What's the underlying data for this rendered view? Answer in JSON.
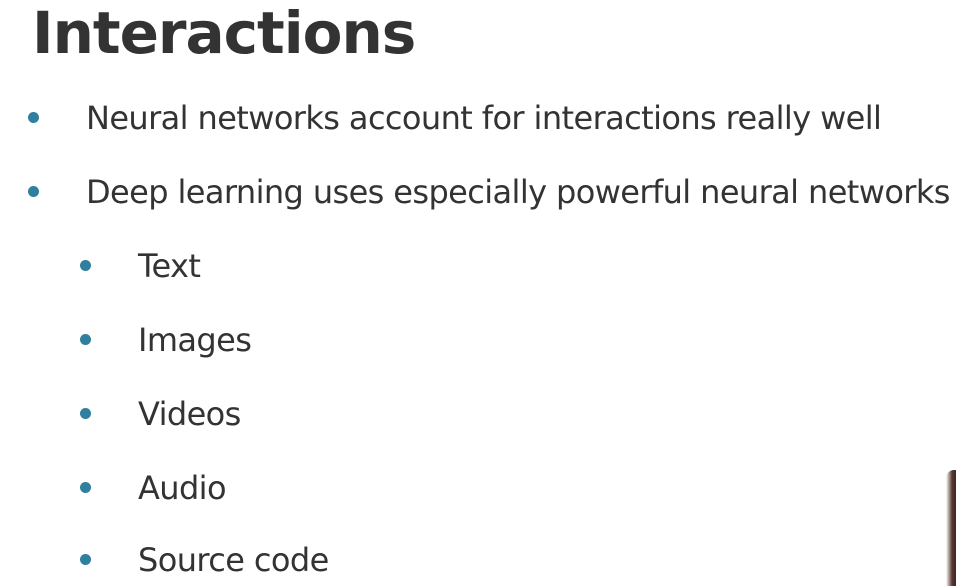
{
  "slide": {
    "title": "Interactions",
    "bullets": [
      "Neural networks account for interactions really well",
      "Deep learning uses especially powerful neural networks"
    ],
    "sub_bullets": [
      "Text",
      "Images",
      "Videos",
      "Audio",
      "Source code"
    ],
    "colors": {
      "bullet": "#2f7f9e",
      "text": "#333333",
      "background": "#ffffff"
    }
  }
}
